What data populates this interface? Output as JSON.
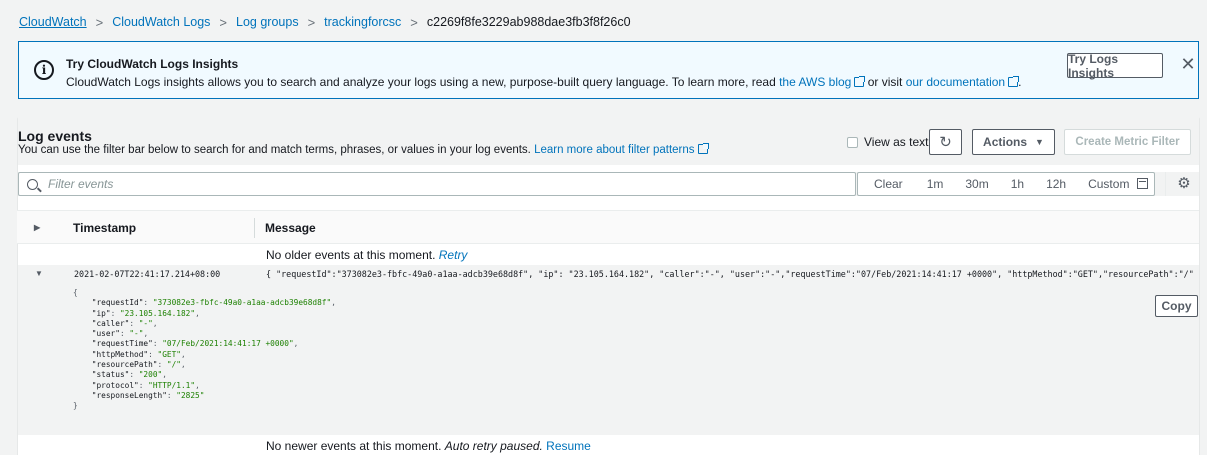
{
  "breadcrumb": {
    "items": [
      "CloudWatch",
      "CloudWatch Logs",
      "Log groups",
      "trackingforcsc"
    ],
    "current": "c2269f8fe3229ab988dae3fb3f8f26c0",
    "separator": ">"
  },
  "banner": {
    "title": "Try CloudWatch Logs Insights",
    "desc_prefix": "CloudWatch Logs insights allows you to search and analyze your logs using a new, purpose-built query language. To learn more, read ",
    "blog_link": "the AWS blog",
    "desc_middle": " or visit ",
    "doc_link": "our documentation",
    "try_button": "Try Logs Insights",
    "close": "✕"
  },
  "log_events": {
    "title": "Log events",
    "desc_prefix": "You can use the filter bar below to search for and match terms, phrases, or values in your log events. ",
    "filter_link": "Learn more about filter patterns",
    "view_as_text": "View as text",
    "actions_label": "Actions",
    "create_metric_filter": "Create Metric Filter"
  },
  "filter": {
    "placeholder": "Filter events",
    "ranges": [
      "Clear",
      "1m",
      "30m",
      "1h",
      "12h",
      "Custom"
    ]
  },
  "table": {
    "col_timestamp": "Timestamp",
    "col_message": "Message",
    "older_note": "No older events at this moment.",
    "older_retry": "Retry",
    "newer_note": "No newer events at this moment.",
    "newer_paused": "Auto retry paused.",
    "newer_resume": "Resume",
    "copy_label": "Copy"
  },
  "event": {
    "timestamp": "2021-02-07T22:41:17.214+08:00",
    "message": "{ \"requestId\":\"373082e3-fbfc-49a0-a1aa-adcb39e68d8f\", \"ip\": \"23.105.164.182\", \"caller\":\"-\", \"user\":\"-\",\"requestTime\":\"07/Feb/2021:14:41:17 +0000\", \"httpMethod\":\"GET\",\"resourcePath\":\"/\", \"…",
    "fields": [
      {
        "key": "requestId",
        "value": "373082e3-fbfc-49a0-a1aa-adcb39e68d8f"
      },
      {
        "key": "ip",
        "value": "23.105.164.182"
      },
      {
        "key": "caller",
        "value": "-"
      },
      {
        "key": "user",
        "value": "-"
      },
      {
        "key": "requestTime",
        "value": "07/Feb/2021:14:41:17 +0000"
      },
      {
        "key": "httpMethod",
        "value": "GET"
      },
      {
        "key": "resourcePath",
        "value": "/"
      },
      {
        "key": "status",
        "value": "200"
      },
      {
        "key": "protocol",
        "value": "HTTP/1.1"
      },
      {
        "key": "responseLength",
        "value": "2825"
      }
    ]
  },
  "colors": {
    "link": "#0073bb",
    "json_value": "#1d8102",
    "banner_bg": "#f1faff"
  }
}
